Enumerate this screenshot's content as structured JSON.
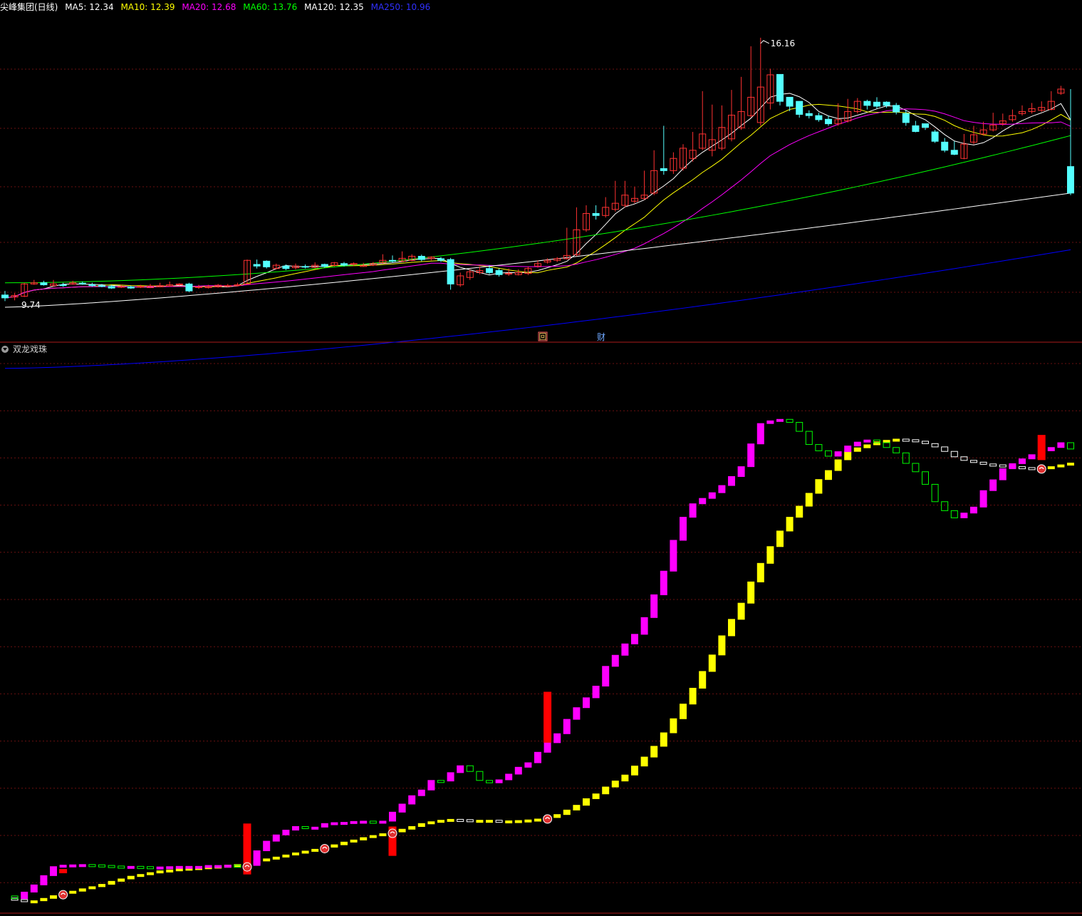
{
  "header": {
    "stock_name": "尖峰集团(日线)",
    "ma": [
      {
        "label": "MA5: 12.34",
        "color": "#ffffff"
      },
      {
        "label": "MA10: 12.39",
        "color": "#ffff00"
      },
      {
        "label": "MA20: 12.68",
        "color": "#ff00ff"
      },
      {
        "label": "MA60: 13.76",
        "color": "#00ff00"
      },
      {
        "label": "MA120: 12.35",
        "color": "#ffffff"
      },
      {
        "label": "MA250: 10.96",
        "color": "#0000ff"
      }
    ]
  },
  "indicator": {
    "name": "双龙戏珠"
  },
  "markers": {
    "event1": "回",
    "event2": "财",
    "price_high": "16.16",
    "price_low": "9.74"
  },
  "colors": {
    "up": "#ff3232",
    "down": "#54ffff",
    "ma5": "#ffffff",
    "ma10": "#ffff00",
    "ma20": "#ff00ff",
    "ma60": "#00ff00",
    "ma120": "#ffffff",
    "ma250": "#0000ff",
    "fast": "#ff00ff",
    "slow": "#ffff00",
    "signal": "#ff0000"
  },
  "chart_data": [
    {
      "type": "candlestick",
      "title": "尖峰集团(日线)",
      "x": [
        1,
        2,
        3,
        4,
        5,
        6,
        7,
        8,
        9,
        10,
        11,
        12,
        13,
        14,
        15,
        16,
        17,
        18,
        19,
        20,
        21,
        22,
        23,
        24,
        25,
        26,
        27,
        28,
        29,
        30,
        31,
        32,
        33,
        34,
        35,
        36,
        37,
        38,
        39,
        40,
        41,
        42,
        43,
        44,
        45,
        46,
        47,
        48,
        49,
        50,
        51,
        52,
        53,
        54,
        55,
        56,
        57,
        58,
        59,
        60,
        61,
        62,
        63,
        64,
        65,
        66,
        67,
        68,
        69,
        70,
        71,
        72,
        73,
        74,
        75,
        76,
        77,
        78,
        79,
        80,
        81,
        82,
        83,
        84,
        85,
        86,
        87,
        88,
        89,
        90,
        91,
        92,
        93,
        94,
        95,
        96,
        97,
        98,
        99,
        100,
        101,
        102,
        103,
        104,
        105,
        106,
        107,
        108,
        109,
        110,
        111
      ],
      "open": [
        9.85,
        9.8,
        9.82,
        10.12,
        10.15,
        10.08,
        10.1,
        10.12,
        10.14,
        10.1,
        10.08,
        10.06,
        10.04,
        10.05,
        10.04,
        10.03,
        10.05,
        10.07,
        10.1,
        10.12,
        10.04,
        10.03,
        10.05,
        10.06,
        10.09,
        10.12,
        10.6,
        10.68,
        10.5,
        10.56,
        10.52,
        10.55,
        10.53,
        10.6,
        10.58,
        10.62,
        10.6,
        10.55,
        10.58,
        10.64,
        10.7,
        10.68,
        10.7,
        10.8,
        10.75,
        10.74,
        10.72,
        10.1,
        10.28,
        10.4,
        10.5,
        10.45,
        10.38,
        10.35,
        10.38,
        10.56,
        10.66,
        10.7,
        10.74,
        10.84,
        11.45,
        11.85,
        11.8,
        11.95,
        12.05,
        12.15,
        12.22,
        12.35,
        12.95,
        12.9,
        12.96,
        13.2,
        13.45,
        13.4,
        13.45,
        13.68,
        13.95,
        14.25,
        14.08,
        14.56,
        15.26,
        14.7,
        14.6,
        14.3,
        14.25,
        14.16,
        14.05,
        14.12,
        14.35,
        14.6,
        14.58,
        14.58,
        14.5,
        14.3,
        14.0,
        14.05,
        13.85,
        13.6,
        13.4,
        13.2,
        13.6,
        13.8,
        13.9,
        14.05,
        14.15,
        14.3,
        14.35,
        14.38,
        14.4,
        14.8,
        13.0
      ],
      "close": [
        9.78,
        9.84,
        10.12,
        10.15,
        10.1,
        10.12,
        10.08,
        10.15,
        10.13,
        10.08,
        10.06,
        10.02,
        10.06,
        10.02,
        10.06,
        10.07,
        10.08,
        10.1,
        10.12,
        9.95,
        10.05,
        10.06,
        10.09,
        10.08,
        10.1,
        10.7,
        10.56,
        10.54,
        10.58,
        10.5,
        10.56,
        10.54,
        10.58,
        10.55,
        10.64,
        10.58,
        10.62,
        10.58,
        10.62,
        10.7,
        10.68,
        10.75,
        10.8,
        10.72,
        10.78,
        10.7,
        10.12,
        10.32,
        10.42,
        10.45,
        10.4,
        10.35,
        10.38,
        10.4,
        10.5,
        10.62,
        10.7,
        10.74,
        10.82,
        11.45,
        11.85,
        11.8,
        12.0,
        12.1,
        12.3,
        12.22,
        12.3,
        12.9,
        12.9,
        13.2,
        13.45,
        13.4,
        13.8,
        13.66,
        13.96,
        14.26,
        14.35,
        14.7,
        14.95,
        15.25,
        14.6,
        14.48,
        14.28,
        14.25,
        14.15,
        14.05,
        14.15,
        14.35,
        14.6,
        14.5,
        14.48,
        14.5,
        14.34,
        14.08,
        13.86,
        13.96,
        13.62,
        13.4,
        13.3,
        13.55,
        13.78,
        13.9,
        14.02,
        14.12,
        14.25,
        14.35,
        14.42,
        14.45,
        14.6,
        14.9,
        12.35
      ],
      "high": [
        9.95,
        9.9,
        10.15,
        10.22,
        10.2,
        10.22,
        10.15,
        10.2,
        10.18,
        10.15,
        10.12,
        10.1,
        10.1,
        10.08,
        10.1,
        10.12,
        10.15,
        10.18,
        10.14,
        10.15,
        10.1,
        10.1,
        10.12,
        10.12,
        10.15,
        10.72,
        10.72,
        10.7,
        10.62,
        10.6,
        10.62,
        10.6,
        10.65,
        10.62,
        10.66,
        10.66,
        10.65,
        10.64,
        10.66,
        10.85,
        10.82,
        10.92,
        10.85,
        10.84,
        10.8,
        10.78,
        10.76,
        10.4,
        10.48,
        10.55,
        10.58,
        10.5,
        10.5,
        10.48,
        10.55,
        10.7,
        10.75,
        10.78,
        11.5,
        12.0,
        12.05,
        12.05,
        12.25,
        12.65,
        12.65,
        12.5,
        12.9,
        13.4,
        14.0,
        13.35,
        13.55,
        13.85,
        14.85,
        14.52,
        14.5,
        14.88,
        15.2,
        15.95,
        16.16,
        15.4,
        14.78,
        14.7,
        14.5,
        14.38,
        14.32,
        14.25,
        14.55,
        14.66,
        14.68,
        14.64,
        14.7,
        14.6,
        14.56,
        14.38,
        14.12,
        14.02,
        13.9,
        13.7,
        13.62,
        13.8,
        14.0,
        14.1,
        14.32,
        14.3,
        14.4,
        14.5,
        14.56,
        14.6,
        14.85,
        14.98,
        14.9
      ],
      "low": [
        9.7,
        9.72,
        9.8,
        10.1,
        10.08,
        10.06,
        10.05,
        10.1,
        10.1,
        10.05,
        10.04,
        10.0,
        10.02,
        10.0,
        10.02,
        10.02,
        10.04,
        10.05,
        10.08,
        9.92,
        10.0,
        10.01,
        10.03,
        10.04,
        10.06,
        10.1,
        10.5,
        10.5,
        10.48,
        10.46,
        10.48,
        10.5,
        10.5,
        10.52,
        10.55,
        10.55,
        10.56,
        10.54,
        10.56,
        10.62,
        10.64,
        10.66,
        10.68,
        10.68,
        10.7,
        10.66,
        9.98,
        10.05,
        10.22,
        10.36,
        10.36,
        10.3,
        10.32,
        10.33,
        10.34,
        10.52,
        10.62,
        10.66,
        10.72,
        10.8,
        11.4,
        11.7,
        11.75,
        11.9,
        12.0,
        12.1,
        12.18,
        12.3,
        12.8,
        12.82,
        12.9,
        13.12,
        13.4,
        13.25,
        13.4,
        13.62,
        13.9,
        14.2,
        14.0,
        14.4,
        14.5,
        14.36,
        14.2,
        14.18,
        14.1,
        14.0,
        14.0,
        14.08,
        14.3,
        14.4,
        14.42,
        14.44,
        14.28,
        14.0,
        13.84,
        13.9,
        13.58,
        13.35,
        13.28,
        13.18,
        13.55,
        13.76,
        13.86,
        14.0,
        14.1,
        14.25,
        14.3,
        14.34,
        14.38,
        14.76,
        12.3
      ],
      "ma_labels": [
        "MA5",
        "MA10",
        "MA20",
        "MA60",
        "MA120",
        "MA250"
      ],
      "ma_last": [
        12.34,
        12.39,
        12.68,
        13.76,
        12.35,
        10.96
      ],
      "annotations": [
        "16.16",
        "9.74"
      ]
    },
    {
      "type": "bar",
      "title": "双龙戏珠",
      "x": [
        1,
        2,
        3,
        4,
        5,
        6,
        7,
        8,
        9,
        10,
        11,
        12,
        13,
        14,
        15,
        16,
        17,
        18,
        19,
        20,
        21,
        22,
        23,
        24,
        25,
        26,
        27,
        28,
        29,
        30,
        31,
        32,
        33,
        34,
        35,
        36,
        37,
        38,
        39,
        40,
        41,
        42,
        43,
        44,
        45,
        46,
        47,
        48,
        49,
        50,
        51,
        52,
        53,
        54,
        55,
        56,
        57,
        58,
        59,
        60,
        61,
        62,
        63,
        64,
        65,
        66,
        67,
        68,
        69,
        70,
        71,
        72,
        73,
        74,
        75,
        76,
        77,
        78,
        79,
        80,
        81,
        82,
        83,
        84,
        85,
        86,
        87,
        88,
        89,
        90,
        91,
        92,
        93,
        94,
        95,
        96,
        97,
        98,
        99,
        100,
        101,
        102,
        103,
        104,
        105,
        106,
        107,
        108,
        109,
        110,
        111
      ],
      "fast": [
        1.2,
        0.75,
        1.85,
        3.05,
        4.6,
        6.1,
        6.35,
        6.4,
        6.45,
        6.4,
        6.3,
        6.2,
        6.15,
        6.15,
        6.1,
        6.05,
        6.05,
        6.1,
        6.15,
        6.15,
        6.15,
        6.3,
        6.3,
        6.35,
        6.25,
        6.3,
        8.75,
        10.35,
        11.4,
        12.2,
        12.8,
        12.7,
        12.7,
        13.3,
        13.45,
        13.5,
        13.65,
        13.7,
        13.6,
        13.7,
        15.2,
        16.55,
        17.95,
        18.9,
        20.5,
        20.4,
        21.8,
        22.95,
        22.0,
        20.5,
        20.1,
        20.6,
        21.55,
        22.7,
        23.45,
        25.2,
        26.8,
        28.3,
        30.7,
        32.65,
        34.3,
        36.25,
        39.55,
        41.4,
        43.3,
        44.9,
        47.7,
        51.5,
        55.45,
        60.6,
        64.45,
        66.7,
        67.6,
        68.55,
        69.75,
        71.25,
        72.9,
        76.7,
        80.1,
        80.55,
        80.8,
        80.3,
        78.8,
        76.6,
        75.55,
        74.65,
        75.4,
        76.35,
        77.0,
        77.35,
        76.9,
        76.1,
        75.2,
        73.45,
        72.05,
        69.95,
        67.05,
        65.55,
        64.35,
        65.15,
        66.15,
        68.9,
        70.7,
        72.55,
        73.4,
        74.2,
        74.9,
        75.55,
        76.1,
        76.9,
        75.85
      ],
      "slow": [
        0.85,
        0.6,
        0.4,
        0.4,
        0.8,
        1.25,
        1.65,
        2.0,
        2.4,
        2.75,
        3.15,
        3.65,
        4.05,
        4.5,
        4.8,
        5.1,
        5.4,
        5.55,
        5.75,
        5.85,
        5.95,
        6.1,
        6.2,
        6.35,
        6.45,
        6.55,
        7.1,
        7.4,
        7.7,
        8.05,
        8.4,
        8.7,
        9.0,
        9.35,
        9.75,
        10.2,
        10.55,
        10.95,
        11.3,
        11.6,
        11.9,
        12.35,
        12.8,
        13.3,
        13.6,
        13.85,
        14.0,
        13.95,
        13.85,
        13.85,
        13.85,
        13.75,
        13.75,
        13.8,
        13.9,
        14.05,
        14.3,
        14.8,
        15.55,
        16.35,
        17.45,
        18.25,
        19.4,
        20.4,
        21.4,
        22.9,
        24.4,
        26.2,
        28.45,
        30.8,
        33.25,
        35.9,
        38.7,
        41.45,
        44.65,
        47.4,
        50.1,
        53.65,
        56.75,
        59.55,
        62.15,
        64.45,
        66.3,
        68.45,
        70.75,
        72.25,
        74.05,
        75.45,
        76.05,
        76.55,
        77.05,
        77.3,
        77.5,
        77.4,
        77.15,
        76.75,
        76.2,
        75.45,
        74.55,
        73.95,
        73.65,
        73.35,
        73.2,
        73.1,
        72.9,
        72.75,
        72.65,
        72.75,
        72.9,
        73.2,
        73.5
      ],
      "signal_x": [
        7,
        26,
        41,
        57,
        108
      ],
      "signal_top": [
        5.7,
        13.3,
        12.8,
        35.3,
        78.2
      ],
      "signal_bottom": [
        5.0,
        4.8,
        7.9,
        26.8,
        74.0
      ],
      "pearl_x": [
        7,
        26,
        34,
        41,
        57,
        108
      ],
      "ylim": [
        0,
        100
      ]
    }
  ]
}
